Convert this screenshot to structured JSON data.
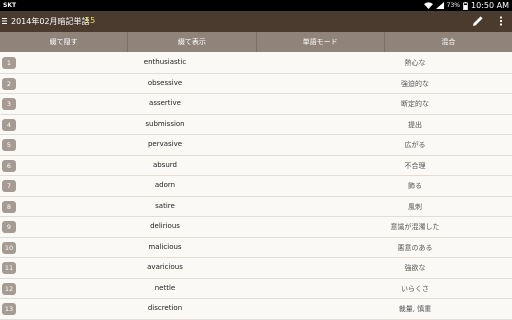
{
  "status_bar": {
    "carrier": "SKT",
    "battery": "73%",
    "time": "10:50 AM"
  },
  "action_bar": {
    "title": "2014年02月暗記単語",
    "count": "15",
    "icons": [
      "menu-icon",
      "pencil-icon",
      "overflow-icon"
    ]
  },
  "columns": {
    "hide_word": "綴て隠す",
    "show_word": "綴て表示",
    "word_mode": "単語モード",
    "mixed": "混合"
  },
  "colors": {
    "action_bar": "#4b3b2e",
    "column_bar": "#908379",
    "number_badge": "#a59b92",
    "count_accent": "#e8e05a"
  },
  "rows": [
    {
      "num": "1",
      "word": "enthusiastic",
      "meaning": "熱心な"
    },
    {
      "num": "2",
      "word": "obsessive",
      "meaning": "強迫的な"
    },
    {
      "num": "3",
      "word": "assertive",
      "meaning": "断定的な"
    },
    {
      "num": "4",
      "word": "submission",
      "meaning": "提出"
    },
    {
      "num": "5",
      "word": "pervasive",
      "meaning": "広がる"
    },
    {
      "num": "6",
      "word": "absurd",
      "meaning": "不合理"
    },
    {
      "num": "7",
      "word": "adorn",
      "meaning": "飾る"
    },
    {
      "num": "8",
      "word": "satire",
      "meaning": "風刺"
    },
    {
      "num": "9",
      "word": "delirious",
      "meaning": "意識が混濁した"
    },
    {
      "num": "10",
      "word": "malicious",
      "meaning": "悪意のある"
    },
    {
      "num": "11",
      "word": "avaricious",
      "meaning": "強欲な"
    },
    {
      "num": "12",
      "word": "nettle",
      "meaning": "いらくさ"
    },
    {
      "num": "13",
      "word": "discretion",
      "meaning": "裁量, 慎重"
    }
  ]
}
